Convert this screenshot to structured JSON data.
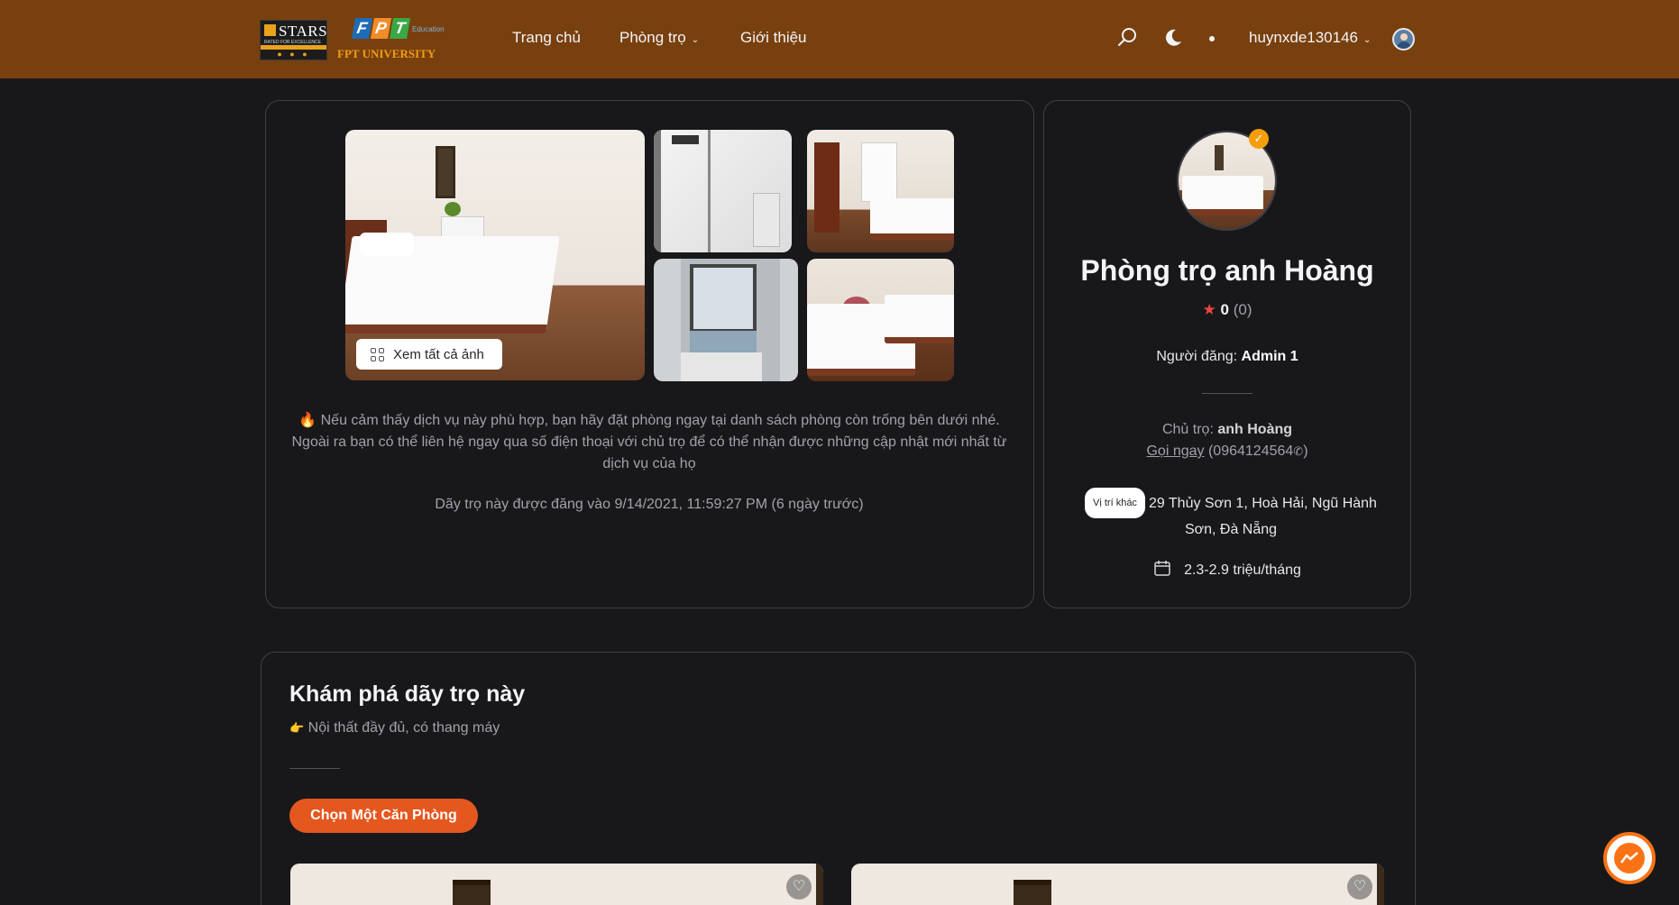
{
  "header": {
    "logo_stars_text": "STARS",
    "logo_stars_sub": "RATED FOR EXCELLENCE",
    "logo_fpt_letters": [
      "F",
      "P",
      "T"
    ],
    "logo_fpt_edu": "Education",
    "logo_fpt_university": "FPT UNIVERSITY",
    "nav": {
      "home": "Trang chủ",
      "rooms": "Phòng trọ",
      "about": "Giới thiệu"
    },
    "username": "huynxde130146"
  },
  "gallery": {
    "see_all_label": "Xem tất cả ảnh"
  },
  "description": {
    "text": "🔥 Nếu cảm thấy dịch vụ này phù hợp, bạn hãy đặt phòng ngay tại danh sách phòng còn trống bên dưới nhé. Ngoài ra bạn có thể liên hệ ngay qua số điện thoại với chủ trọ để có thể nhận được những cập nhật mới nhất từ dịch vụ của họ",
    "posted": "Dãy trọ này được đăng vào 9/14/2021, 11:59:27 PM (6 ngày trước)"
  },
  "host": {
    "name": "Phòng trọ anh Hoàng",
    "rating": "0",
    "rating_count": "(0)",
    "poster_label": "Người đăng:",
    "poster_name": "Admin 1",
    "owner_label": "Chủ trọ:",
    "owner_name": "anh Hoàng",
    "call_now": "Gọi ngay",
    "phone": "(0964124564",
    "phone_close": ")",
    "other_location": "Vị trí khác",
    "address": "29 Thủy Sơn 1, Hoà Hải, Ngũ Hành Sơn, Đà Nẵng",
    "price": "2.3-2.9 triệu/tháng"
  },
  "explore": {
    "title": "Khám phá dãy trọ này",
    "subtitle": "Nội thất đầy đủ, có thang máy",
    "pick_button": "Chọn Một Căn Phòng"
  },
  "colors": {
    "header_bg": "#78400f",
    "accent": "#e4571f",
    "verified": "#f59e0b",
    "messenger": "#f97316"
  }
}
